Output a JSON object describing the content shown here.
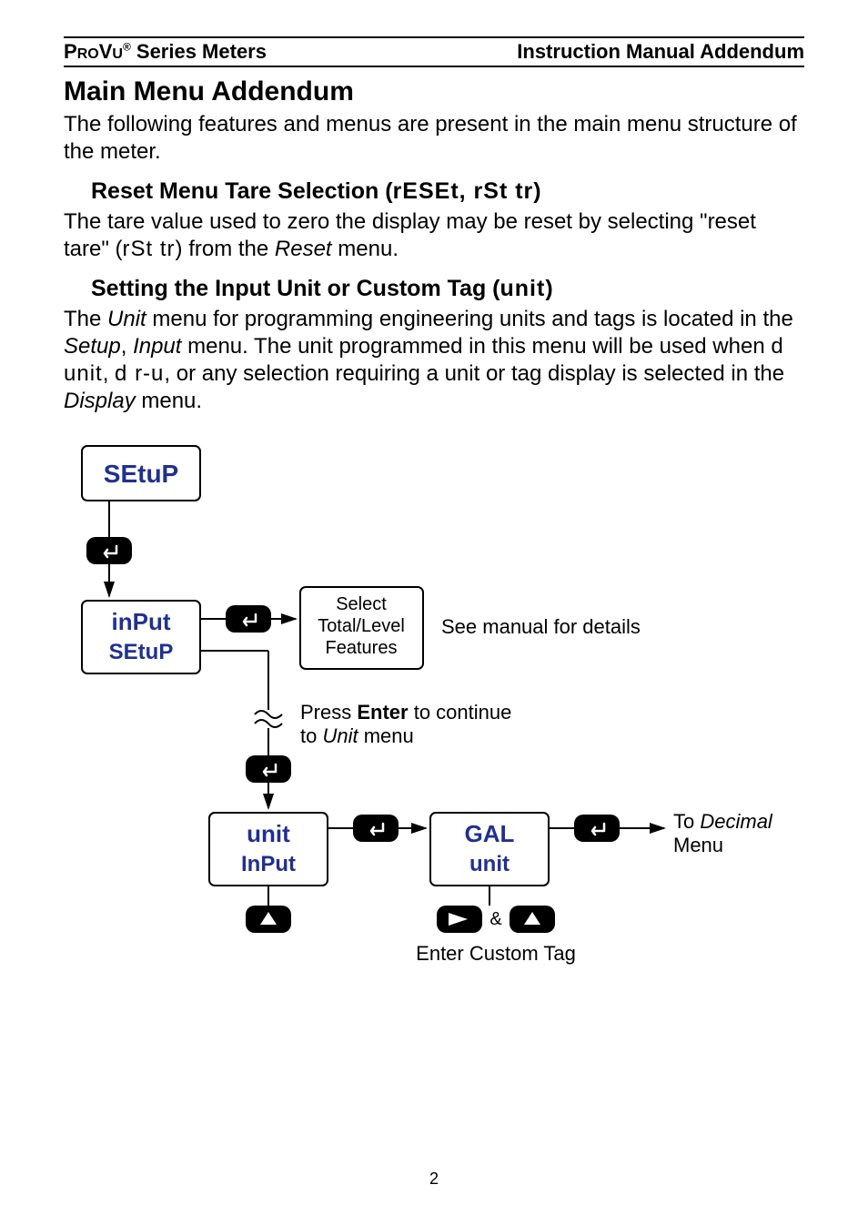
{
  "header": {
    "brand_pro": "P",
    "brand_ro": "RO",
    "brand_v": "V",
    "brand_u": "U",
    "reg": "®",
    "series": " Series Meters",
    "right": "Instruction Manual Addendum"
  },
  "h1": "Main Menu Addendum",
  "p1": "The following features and menus are present in the main menu structure of the meter.",
  "h2a_prefix": "Reset Menu Tare Selection (",
  "h2a_seg": "rESEt, rSt  tr",
  "h2a_suffix": ")",
  "p2_a": "The tare value used to zero the display may be reset by selecting \"reset tare\" (",
  "p2_seg": "rSt  tr",
  "p2_b": ") from the ",
  "p2_reset": "Reset",
  "p2_c": " menu.",
  "h2b_prefix": "Setting the Input Unit or Custom Tag (",
  "h2b_seg": "unit",
  "h2b_suffix": ")",
  "p3_a": "The ",
  "p3_unit": "Unit",
  "p3_b": " menu for programming engineering units and tags is located in the ",
  "p3_setup": "Setup",
  "p3_c": ", ",
  "p3_input": "Input",
  "p3_d": " menu. The unit programmed in this menu will be used when ",
  "p3_seg1": "d unit",
  "p3_e": ", ",
  "p3_seg2": "d r-u",
  "p3_f": ", or any selection requiring a unit or tag display is selected in the ",
  "p3_display": "Display",
  "p3_g": " menu.",
  "diagram": {
    "box_setup": "SEtuP",
    "box_input_top": "inPut",
    "box_input_bot": "SEtuP",
    "select_l1": "Select",
    "select_l2": "Total/Level",
    "select_l3": "Features",
    "see_manual": "See manual for details",
    "press_enter_a": "Press ",
    "press_enter_b": "Enter",
    "press_enter_c": " to continue",
    "to_unit_a": "to ",
    "to_unit_b": "Unit",
    "to_unit_c": " menu",
    "box_unit_top": "unit",
    "box_unit_bot": "InPut",
    "box_gal_top": "GAL",
    "box_gal_bot": "unit",
    "to_decimal_a": "To ",
    "to_decimal_b": "Decimal",
    "to_decimal_c": "Menu",
    "amp": "&",
    "enter_custom": "Enter Custom Tag"
  },
  "page_number": "2"
}
